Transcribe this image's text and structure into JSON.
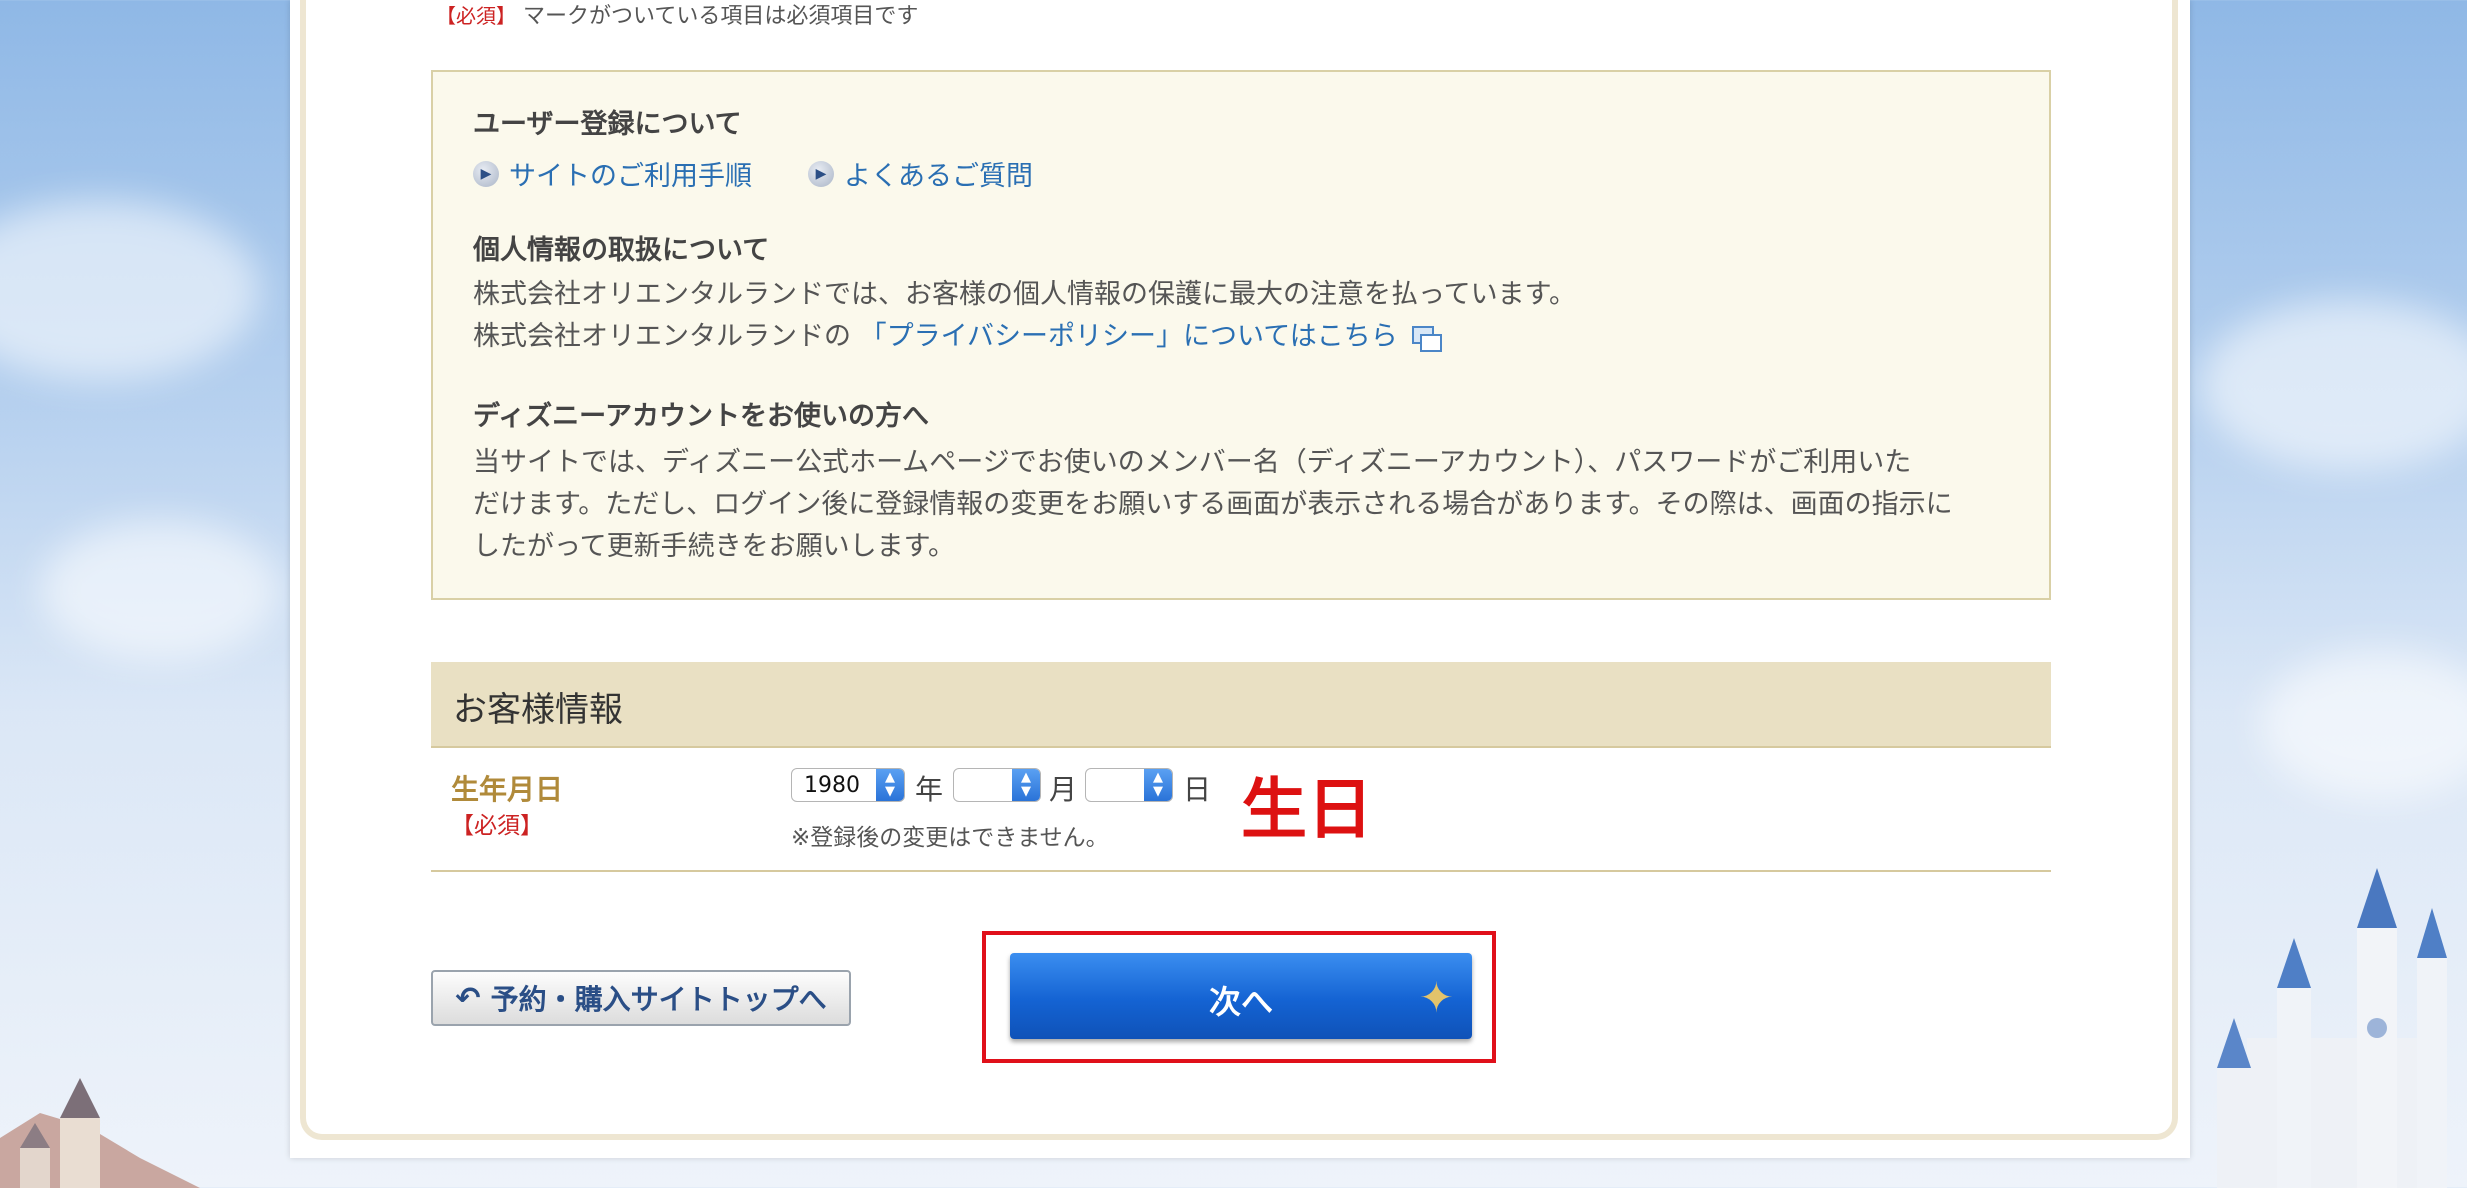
{
  "header_note": {
    "required_mark": "【必須】",
    "text": "マークがついている項目は必須項目です"
  },
  "info": {
    "user_registration_title": "ユーザー登録について",
    "links": [
      {
        "label": "サイトのご利用手順",
        "icon": "arrow-circle-icon"
      },
      {
        "label": "よくあるご質問",
        "icon": "arrow-circle-icon"
      }
    ],
    "privacy_title": "個人情報の取扱について",
    "privacy_line1": "株式会社オリエンタルランドでは、お客様の個人情報の保護に最大の注意を払っています。",
    "privacy_line2_prefix": "株式会社オリエンタルランドの",
    "privacy_link": "「プライバシーポリシー」についてはこちら",
    "disney_title": "ディズニーアカウントをお使いの方へ",
    "disney_line1": "当サイトでは、ディズニー公式ホームページでお使いのメンバー名（ディズニーアカウント）、パスワードがご利用いた",
    "disney_line2": "だけます。ただし、ログイン後に登録情報の変更をお願いする画面が表示される場合があります。その際は、画面の指示に",
    "disney_line3": "したがって更新手続きをお願いします。"
  },
  "customer_section": {
    "title": "お客様情報",
    "birthday": {
      "label": "生年月日",
      "required": "【必須】",
      "year_value": "1980",
      "year_unit": "年",
      "month_value": "",
      "month_unit": "月",
      "day_value": "",
      "day_unit": "日",
      "note": "※登録後の変更はできません。",
      "annotation": "生日"
    }
  },
  "buttons": {
    "back_label": "予約・購入サイトトップへ",
    "back_icon": "undo-arrow-icon",
    "next_label": "次へ",
    "next_icon": "sparkle-icon"
  },
  "colors": {
    "link": "#2a6fb3",
    "required": "#cc2222",
    "primary_button": "#1463d3",
    "highlight": "#e0101a"
  }
}
